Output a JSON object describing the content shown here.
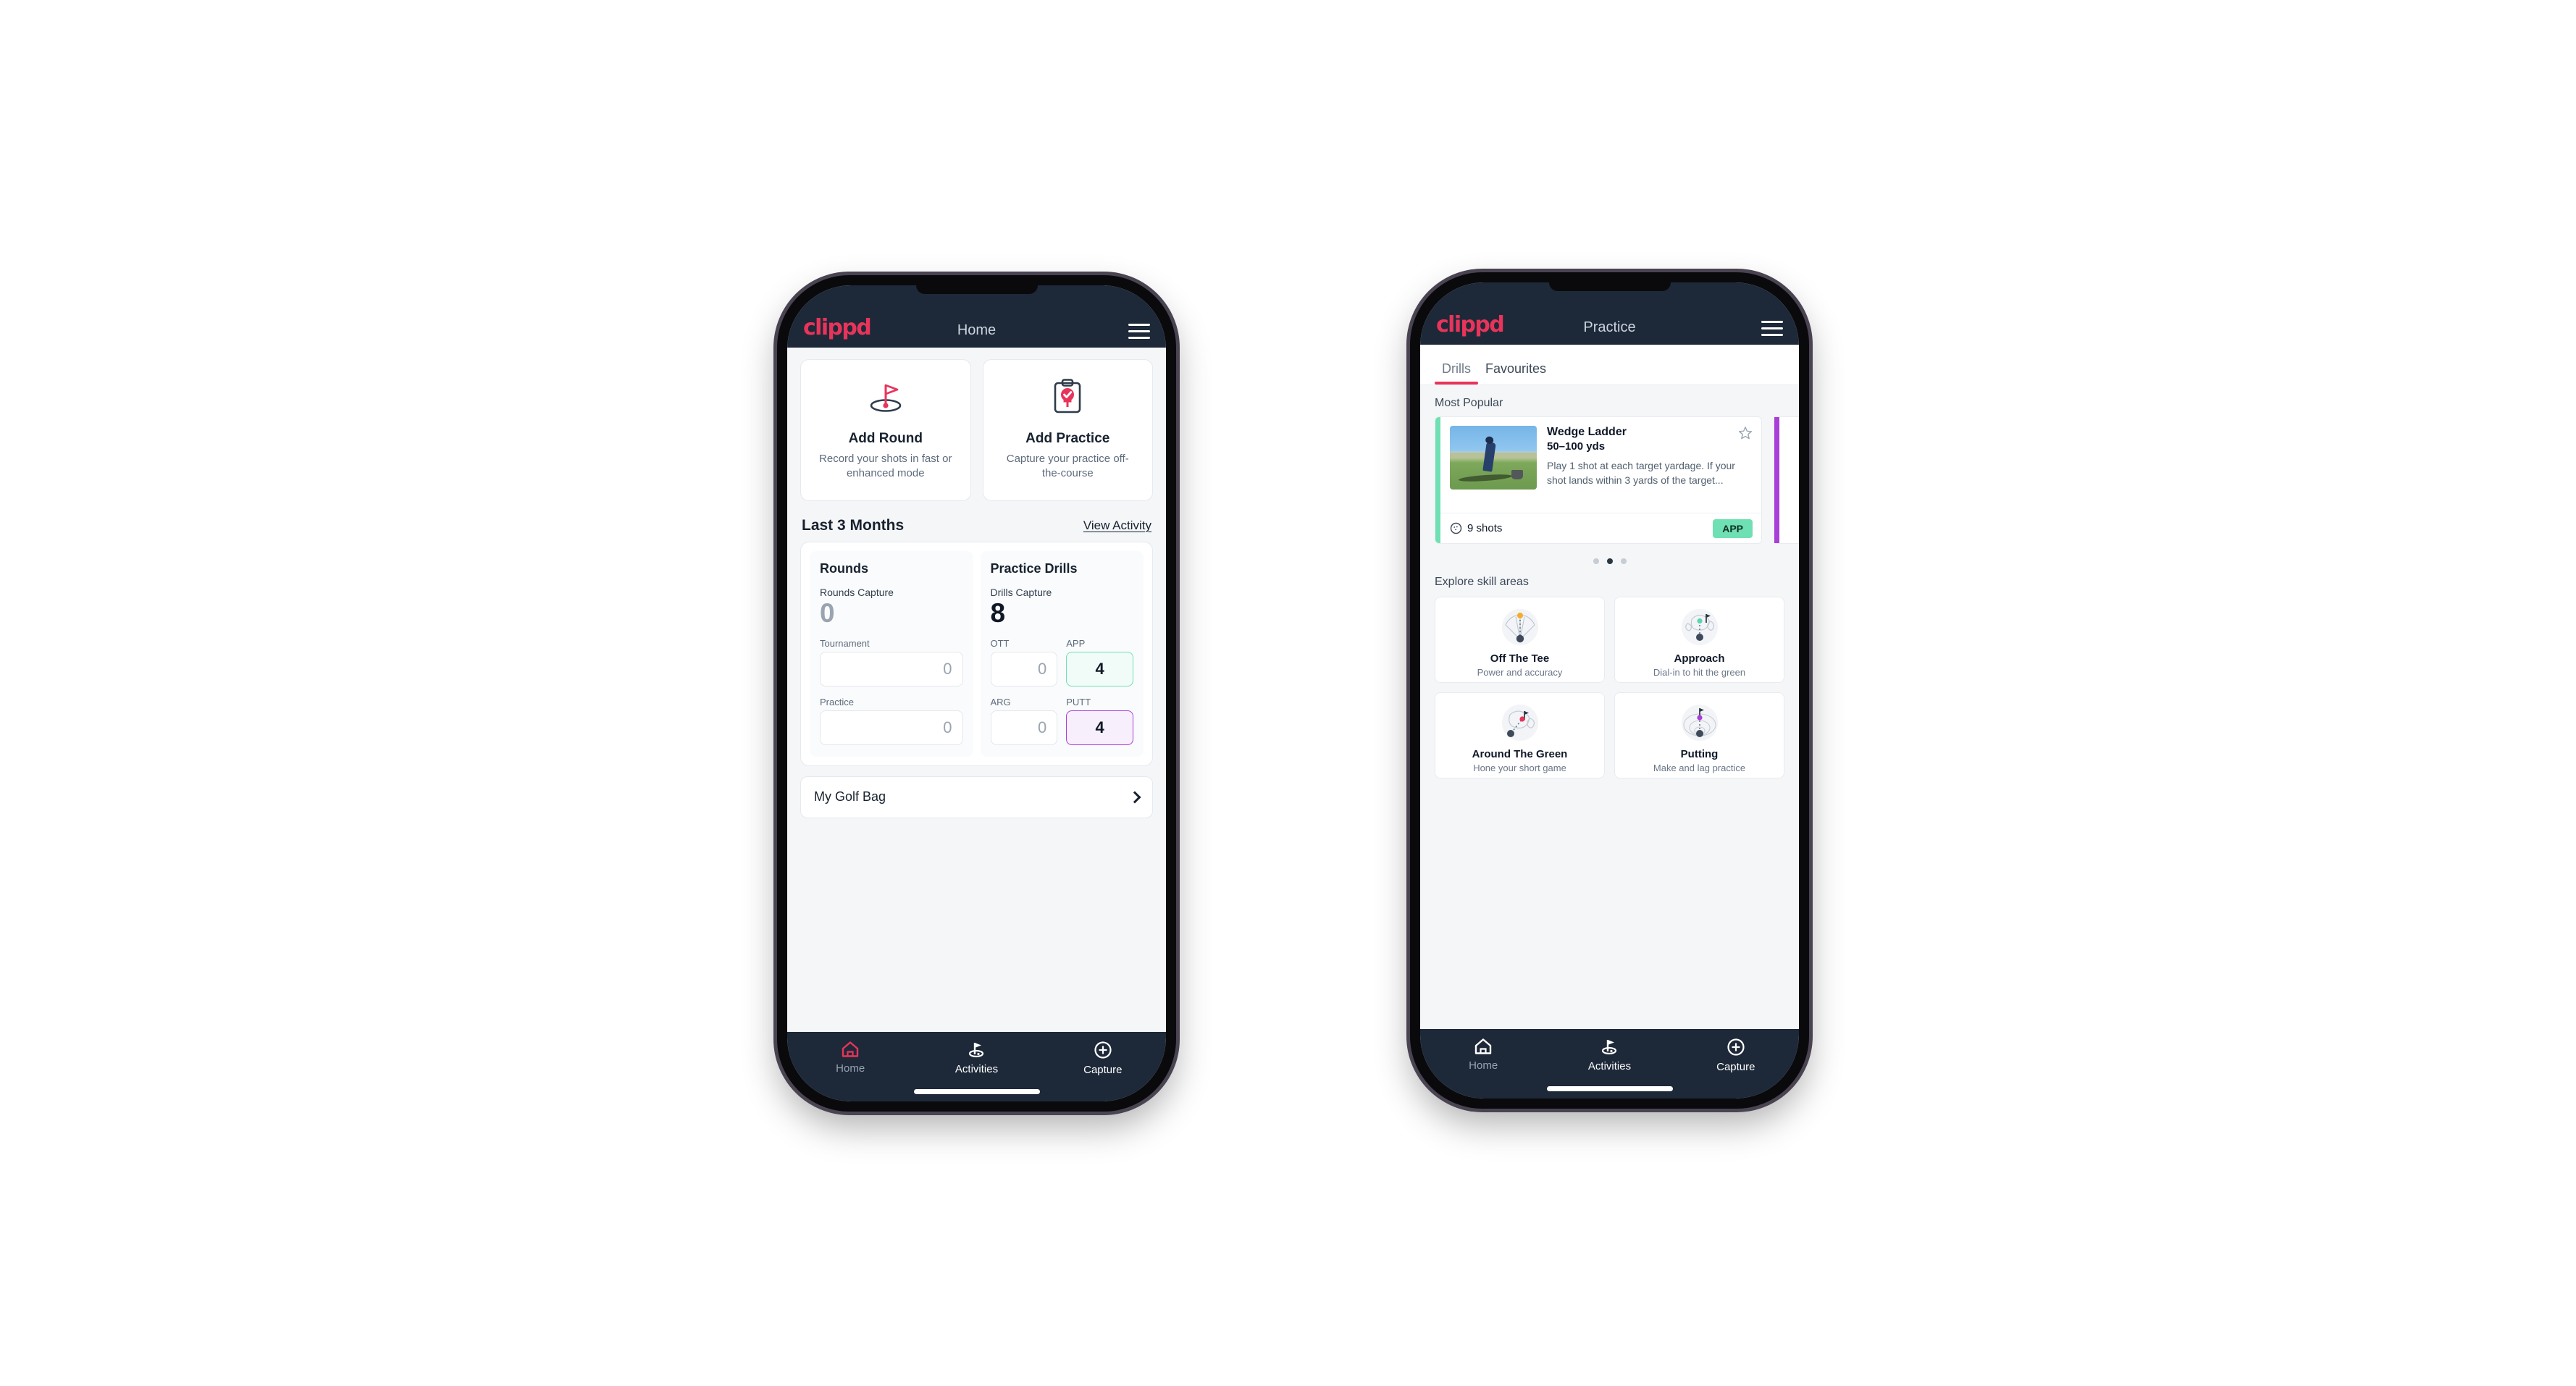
{
  "colors": {
    "brand_pink": "#e8345a",
    "nav_dark": "#1d2939",
    "accent_mint": "#6fe0b4",
    "accent_purple": "#a93fd9",
    "page_bg": "#ffffff",
    "screen_bg": "#f4f6f8"
  },
  "phone_home": {
    "appbar": {
      "logo": "clippd",
      "title": "Home",
      "menu_icon": "hamburger-icon"
    },
    "quick_actions": [
      {
        "icon": "golf-flag-icon",
        "title": "Add Round",
        "subtitle": "Record your shots in fast or enhanced mode"
      },
      {
        "icon": "clipboard-check-icon",
        "title": "Add Practice",
        "subtitle": "Capture your practice off-the-course"
      }
    ],
    "section": {
      "title": "Last 3 Months",
      "action": "View Activity"
    },
    "stats": {
      "rounds": {
        "title": "Rounds",
        "capture_label": "Rounds Capture",
        "capture_value": "0",
        "fields": [
          {
            "label": "Tournament",
            "value": "0",
            "accent": "none"
          },
          {
            "label": "Practice",
            "value": "0",
            "accent": "none"
          }
        ]
      },
      "drills": {
        "title": "Practice Drills",
        "capture_label": "Drills Capture",
        "capture_value": "8",
        "fields": [
          {
            "label": "OTT",
            "value": "0",
            "accent": "none"
          },
          {
            "label": "APP",
            "value": "4",
            "accent": "green"
          },
          {
            "label": "ARG",
            "value": "0",
            "accent": "none"
          },
          {
            "label": "PUTT",
            "value": "4",
            "accent": "purple"
          }
        ]
      }
    },
    "golf_bag": {
      "label": "My Golf Bag",
      "chevron": "chevron-right-icon"
    },
    "bottom_nav": [
      {
        "icon": "home-icon",
        "label": "Home",
        "active": true
      },
      {
        "icon": "golf-flag-nav-icon",
        "label": "Activities",
        "active": false
      },
      {
        "icon": "plus-circle-icon",
        "label": "Capture",
        "active": false
      }
    ]
  },
  "phone_practice": {
    "appbar": {
      "logo": "clippd",
      "title": "Practice",
      "menu_icon": "hamburger-icon"
    },
    "tabs": [
      {
        "label": "Drills",
        "active": true
      },
      {
        "label": "Favourites",
        "active": false
      }
    ],
    "most_popular": {
      "label": "Most Popular",
      "card": {
        "title": "Wedge Ladder",
        "yardage": "50–100 yds",
        "description": "Play 1 shot at each target yardage. If your shot lands within 3 yards of the target...",
        "shots": "9 shots",
        "shots_icon": "golf-ball-icon",
        "badge": "APP",
        "star_icon": "star-outline-icon",
        "accent": "#6fe0b4",
        "thumbnail": "golfer-chipping-photo"
      },
      "next_card_accent": "#a93fd9",
      "dots": {
        "count": 3,
        "active_index": 1
      }
    },
    "skill_areas": {
      "label": "Explore skill areas",
      "cards": [
        {
          "icon": "off-the-tee-icon",
          "name": "Off The Tee",
          "sub": "Power and accuracy",
          "dot_color": "#f2ae2b"
        },
        {
          "icon": "approach-icon",
          "name": "Approach",
          "sub": "Dial-in to hit the green",
          "dot_color": "#5fd3b0"
        },
        {
          "icon": "around-the-green-icon",
          "name": "Around The Green",
          "sub": "Hone your short game",
          "dot_color": "#e8345a"
        },
        {
          "icon": "putting-icon",
          "name": "Putting",
          "sub": "Make and lag practice",
          "dot_color": "#a93fd9"
        }
      ]
    },
    "bottom_nav": [
      {
        "icon": "home-icon",
        "label": "Home",
        "active": false
      },
      {
        "icon": "golf-flag-nav-icon",
        "label": "Activities",
        "active": true
      },
      {
        "icon": "plus-circle-icon",
        "label": "Capture",
        "active": false
      }
    ]
  }
}
